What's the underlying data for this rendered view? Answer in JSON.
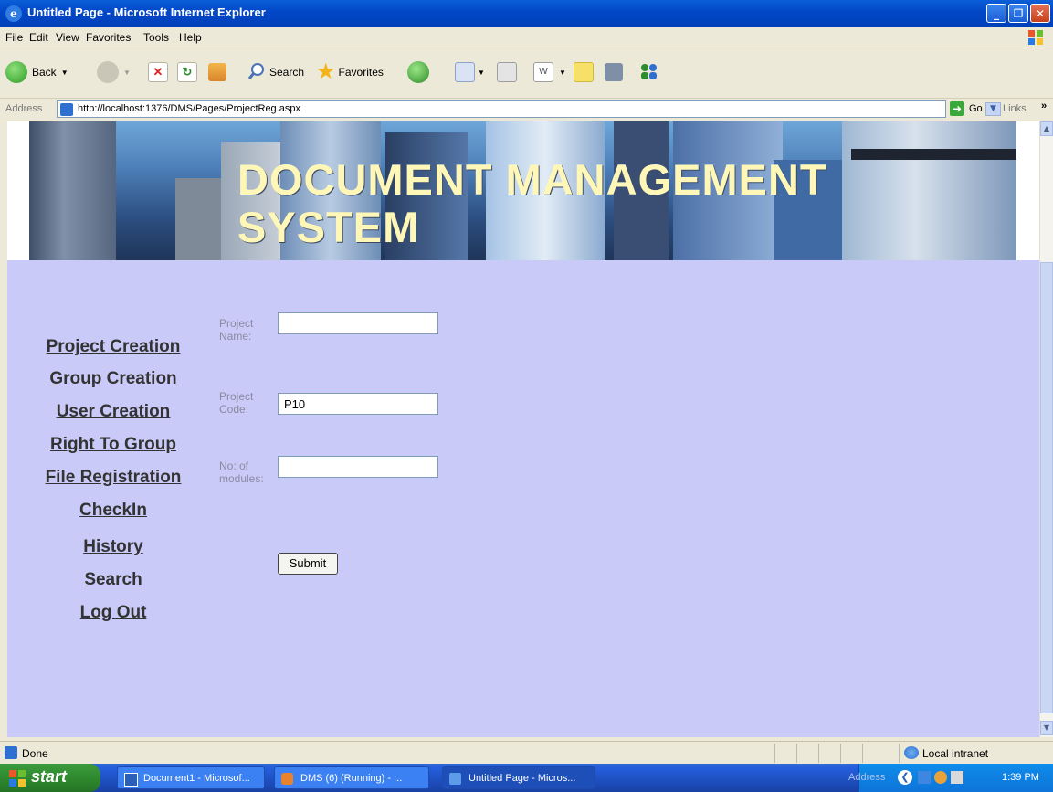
{
  "window": {
    "title": "Untitled Page - Microsoft Internet Explorer",
    "controls": [
      "minimize",
      "maximize",
      "close"
    ]
  },
  "menu": {
    "items": [
      "File",
      "Edit",
      "View",
      "Favorites",
      "Tools",
      "Help"
    ]
  },
  "toolbar": {
    "back_label": "Back",
    "search_label": "Search",
    "favorites_label": "Favorites"
  },
  "address": {
    "label": "Address",
    "url": "http://localhost:1376/DMS/Pages/ProjectReg.aspx",
    "go_label": "Go",
    "links_label": "Links"
  },
  "page": {
    "banner_title_line1": "DOCUMENT MANAGEMENT",
    "banner_title_line2": "SYSTEM",
    "nav": [
      "Project Creation",
      "Group Creation",
      "User Creation",
      "Right To Group",
      "File Registration",
      "CheckIn",
      "History",
      "Search",
      "Log Out"
    ],
    "form": {
      "project_name_label": "Project Name:",
      "project_name_value": "",
      "project_code_label": "Project Code:",
      "project_code_value": "P10",
      "modules_label": "No: of modules:",
      "modules_value": "",
      "submit_label": "Submit"
    },
    "colors": {
      "content_bg": "#CACAF9",
      "banner_text": "#FFF7B8"
    }
  },
  "status": {
    "text": "Done",
    "zone": "Local intranet"
  },
  "taskbar": {
    "start_label": "start",
    "tasks": [
      "Document1 - Microsof...",
      "DMS (6) (Running) - ...",
      "Untitled Page - Micros..."
    ],
    "tray_address_label": "Address",
    "clock": "1:39 PM"
  }
}
